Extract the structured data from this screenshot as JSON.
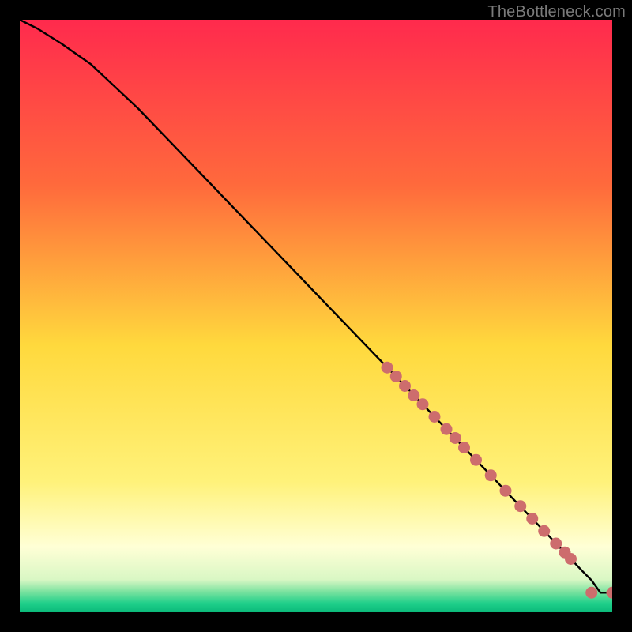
{
  "watermark": "TheBottleneck.com",
  "chart_data": {
    "type": "line",
    "title": "",
    "xlabel": "",
    "ylabel": "",
    "xlim": [
      0,
      100
    ],
    "ylim": [
      0,
      100
    ],
    "grid": false,
    "legend": false,
    "background_gradient": {
      "stops": [
        {
          "offset": 0.0,
          "color": "#ff2a4d"
        },
        {
          "offset": 0.28,
          "color": "#ff6a3c"
        },
        {
          "offset": 0.55,
          "color": "#ffd93d"
        },
        {
          "offset": 0.78,
          "color": "#fff27a"
        },
        {
          "offset": 0.89,
          "color": "#ffffd6"
        },
        {
          "offset": 0.945,
          "color": "#d9f7c4"
        },
        {
          "offset": 0.965,
          "color": "#7de3a0"
        },
        {
          "offset": 0.985,
          "color": "#1fcf8a"
        },
        {
          "offset": 1.0,
          "color": "#0bb97a"
        }
      ]
    },
    "series": [
      {
        "name": "curve",
        "style": "line",
        "x": [
          0,
          3,
          7,
          12,
          20,
          30,
          40,
          50,
          60,
          66,
          70,
          74,
          77,
          80,
          83,
          86,
          89,
          91,
          93,
          95,
          96.5,
          98,
          100
        ],
        "y": [
          100,
          98.5,
          96,
          92.5,
          85,
          74.6,
          64.2,
          53.8,
          43.4,
          37.2,
          33,
          28.8,
          25.7,
          22.6,
          19.4,
          16.3,
          13.2,
          11.1,
          9,
          6.9,
          5.4,
          3.3,
          3.3
        ]
      },
      {
        "name": "markers",
        "style": "dots",
        "x": [
          62,
          63.5,
          65,
          66.5,
          68,
          70,
          72,
          73.5,
          75,
          77,
          79.5,
          82,
          84.5,
          86.5,
          88.5,
          90.5,
          92,
          93,
          96.5,
          100
        ],
        "y": [
          41.3,
          39.8,
          38.2,
          36.6,
          35.1,
          33.0,
          30.9,
          29.4,
          27.8,
          25.7,
          23.1,
          20.5,
          17.9,
          15.8,
          13.7,
          11.6,
          10.1,
          9.0,
          3.3,
          3.3
        ]
      }
    ]
  }
}
